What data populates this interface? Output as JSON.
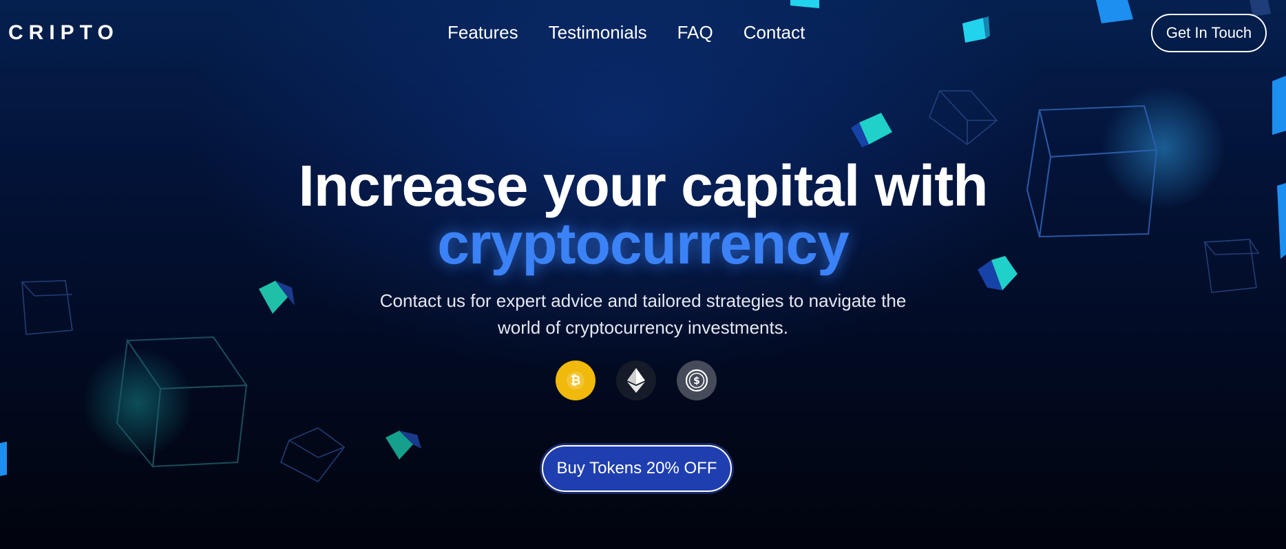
{
  "brand": {
    "logo_text": "CRIPTO"
  },
  "nav": {
    "items": [
      {
        "label": "Features"
      },
      {
        "label": "Testimonials"
      },
      {
        "label": "FAQ"
      },
      {
        "label": "Contact"
      }
    ]
  },
  "header": {
    "cta_label": "Get In Touch"
  },
  "hero": {
    "title_line1": "Increase your capital with",
    "title_accent": "cryptocurrency",
    "subtitle": "Contact us for expert advice and tailored strategies to navigate the world of cryptocurrency investments."
  },
  "coins": [
    {
      "icon": "bitcoin-icon",
      "color": "#f0b90b"
    },
    {
      "icon": "ethereum-icon",
      "color": "#161b29"
    },
    {
      "icon": "dollar-coin-icon",
      "color": "#454b59"
    }
  ],
  "buy_button": {
    "label": "Buy Tokens 20% OFF"
  },
  "colors": {
    "accent": "#3b82f6",
    "button": "#1f3fb0",
    "background": "#020b24"
  }
}
